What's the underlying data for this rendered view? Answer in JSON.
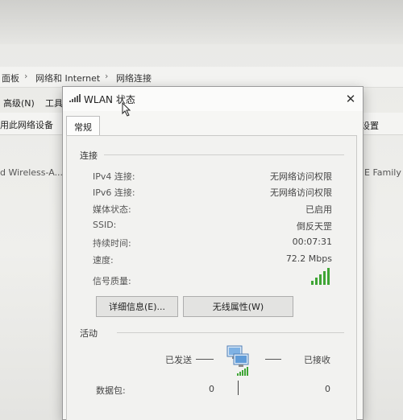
{
  "background": {
    "breadcrumb": [
      "面板",
      "网络和 Internet",
      "网络连接"
    ],
    "menu": [
      "高级(N)",
      "工具"
    ],
    "toolbar": {
      "left": "用此网络设备",
      "right": "设置"
    },
    "adapter": {
      "left": "d Wireless-A...",
      "right": "E Family Co"
    }
  },
  "dialog": {
    "title": "WLAN 状态",
    "close_symbol": "✕",
    "tab": "常规",
    "connection": {
      "heading": "连接",
      "rows": [
        {
          "label": "IPv4 连接:",
          "value": "无网络访问权限"
        },
        {
          "label": "IPv6 连接:",
          "value": "无网络访问权限"
        },
        {
          "label": "媒体状态:",
          "value": "已启用"
        },
        {
          "label": "SSID:",
          "value": "倒反天罡"
        },
        {
          "label": "持续时间:",
          "value": "00:07:31"
        },
        {
          "label": "速度:",
          "value": "72.2 Mbps"
        }
      ],
      "signal_label": "信号质量:",
      "signal_bars": 5
    },
    "buttons": {
      "details": "详细信息(E)...",
      "wireless": "无线属性(W)"
    },
    "activity": {
      "heading": "活动",
      "sent_label": "已发送",
      "received_label": "已接收",
      "packets_label": "数据包:",
      "sent_packets": "0",
      "received_packets": "0"
    }
  },
  "colors": {
    "signal": "#3fa535",
    "dialog_bg": "#f6f6f4"
  }
}
